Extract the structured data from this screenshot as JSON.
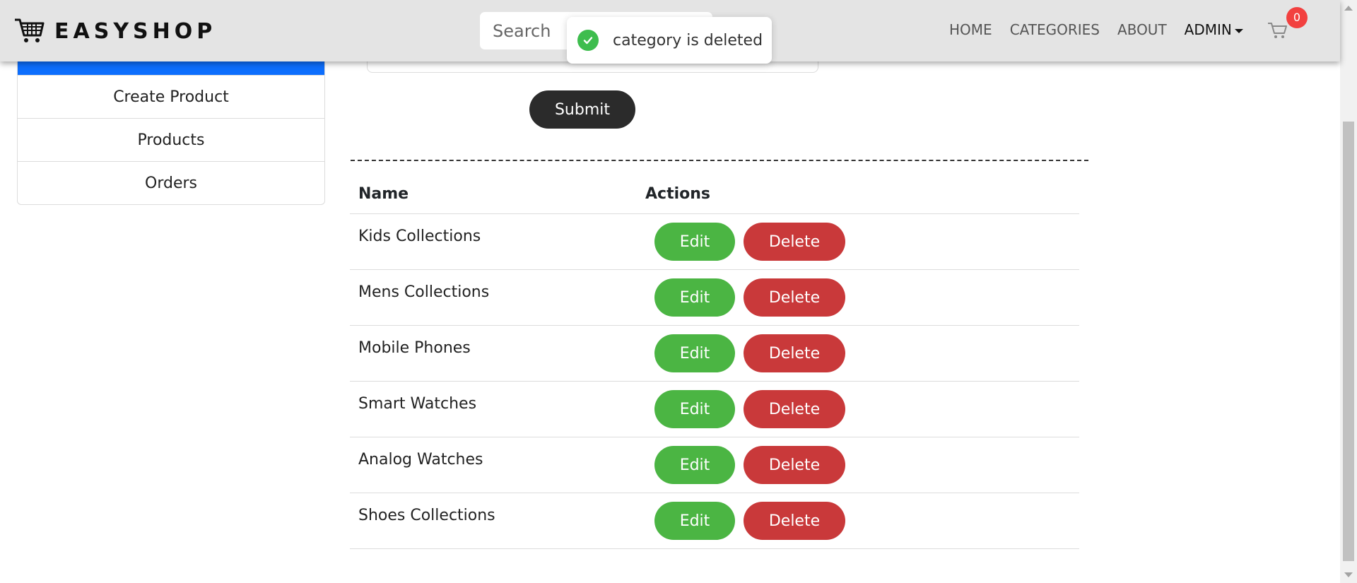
{
  "brand": {
    "name": "EASYSHOP",
    "icon": "shopping-cart-icon"
  },
  "search": {
    "placeholder": "Search"
  },
  "nav": {
    "items": [
      "HOME",
      "CATEGORIES",
      "ABOUT"
    ],
    "admin_label": "ADMIN",
    "cart_count": "0"
  },
  "toast": {
    "message": "category is deleted",
    "icon": "check-circle-icon",
    "color": "#3ebd4e"
  },
  "sidebar": {
    "items": [
      "Create Product",
      "Products",
      "Orders"
    ]
  },
  "form": {
    "submit_label": "Submit"
  },
  "table": {
    "headers": {
      "name": "Name",
      "actions": "Actions"
    },
    "edit_label": "Edit",
    "delete_label": "Delete",
    "rows": [
      "Kids Collections",
      "Mens Collections",
      "Mobile Phones",
      "Smart Watches",
      "Analog Watches",
      "Shoes Collections"
    ]
  },
  "colors": {
    "accent": "#0d6efd",
    "edit": "#4bb543",
    "delete": "#c9393a",
    "submit": "#2b2b2b",
    "badge": "#f2403f"
  }
}
